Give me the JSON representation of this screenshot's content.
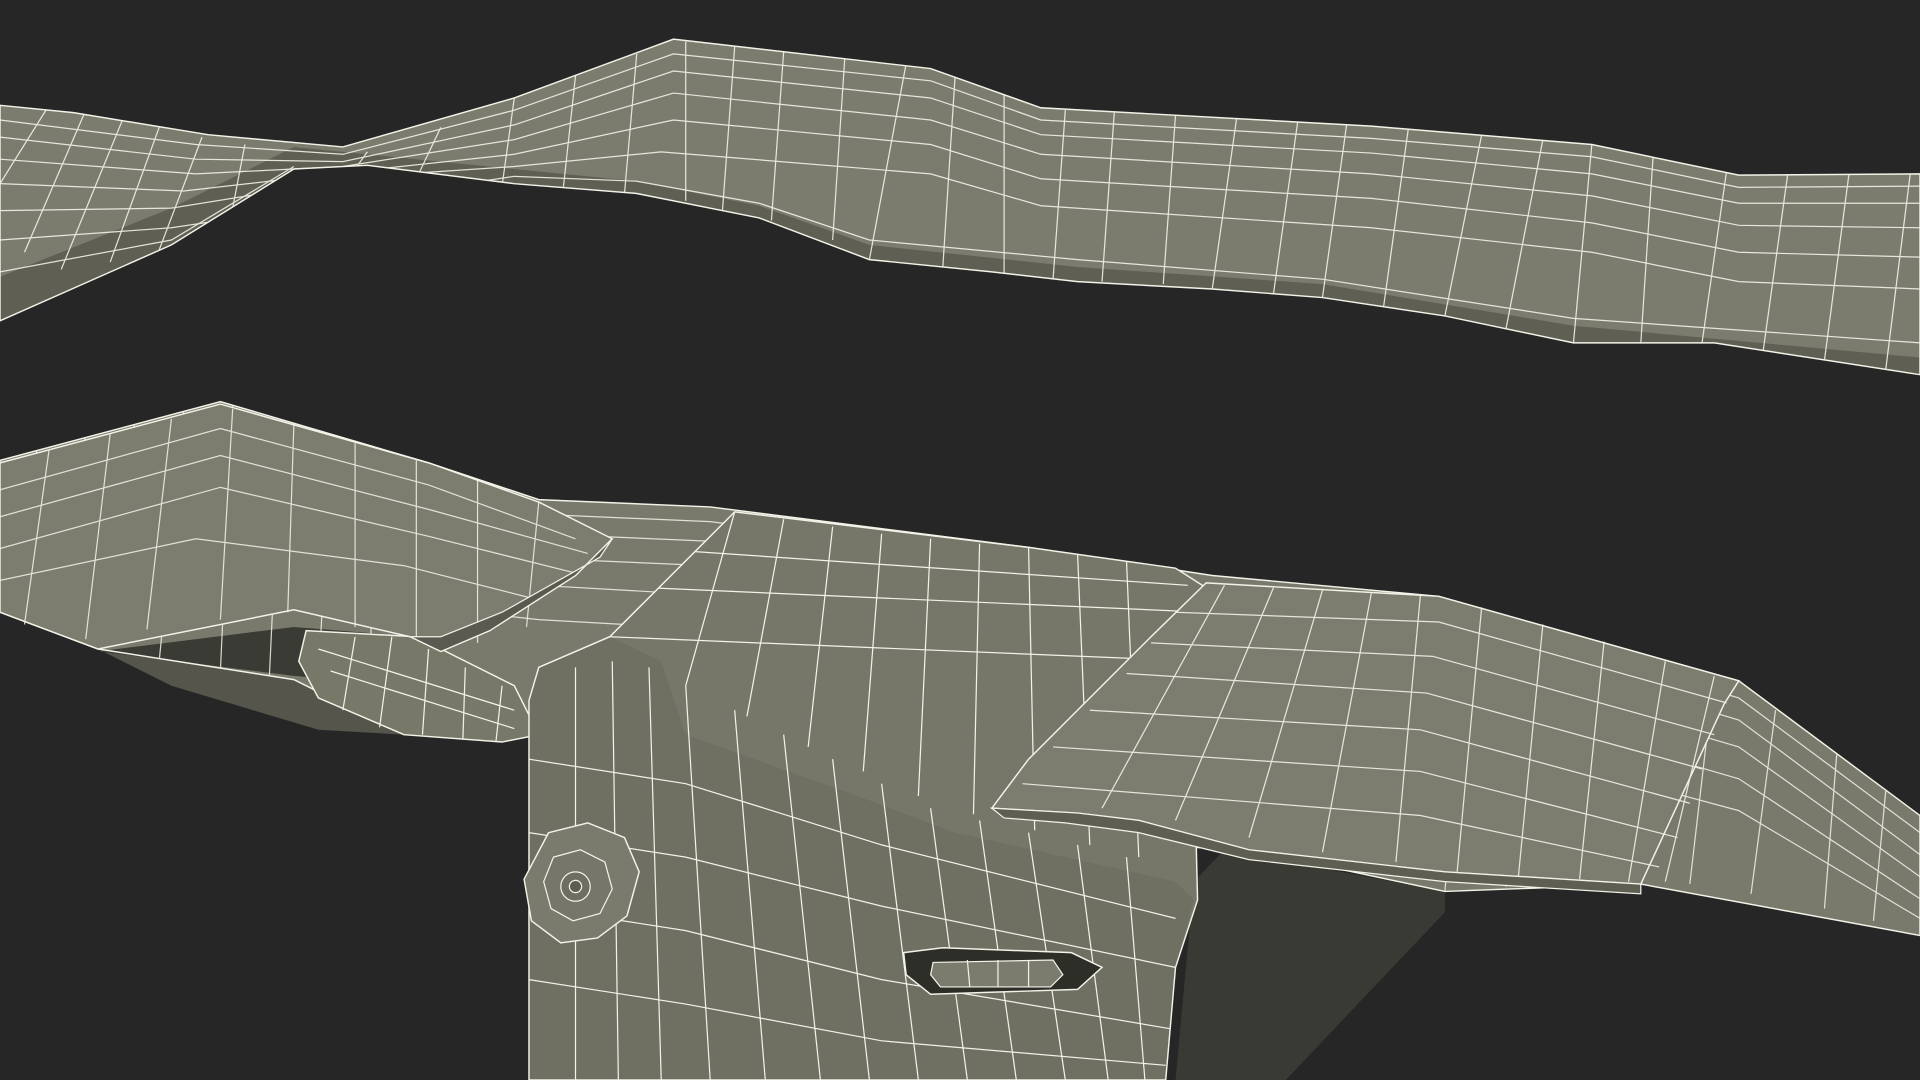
{
  "scene": {
    "subject": "seat-belt-buckle-wireframe-render",
    "colors": {
      "background": "#262626",
      "surface_light": "#7e7e70",
      "surface_mid": "#767668",
      "surface_dark": "#55554b",
      "surface_shadow": "#3d3d36",
      "wire": "#f2f2e8"
    }
  }
}
